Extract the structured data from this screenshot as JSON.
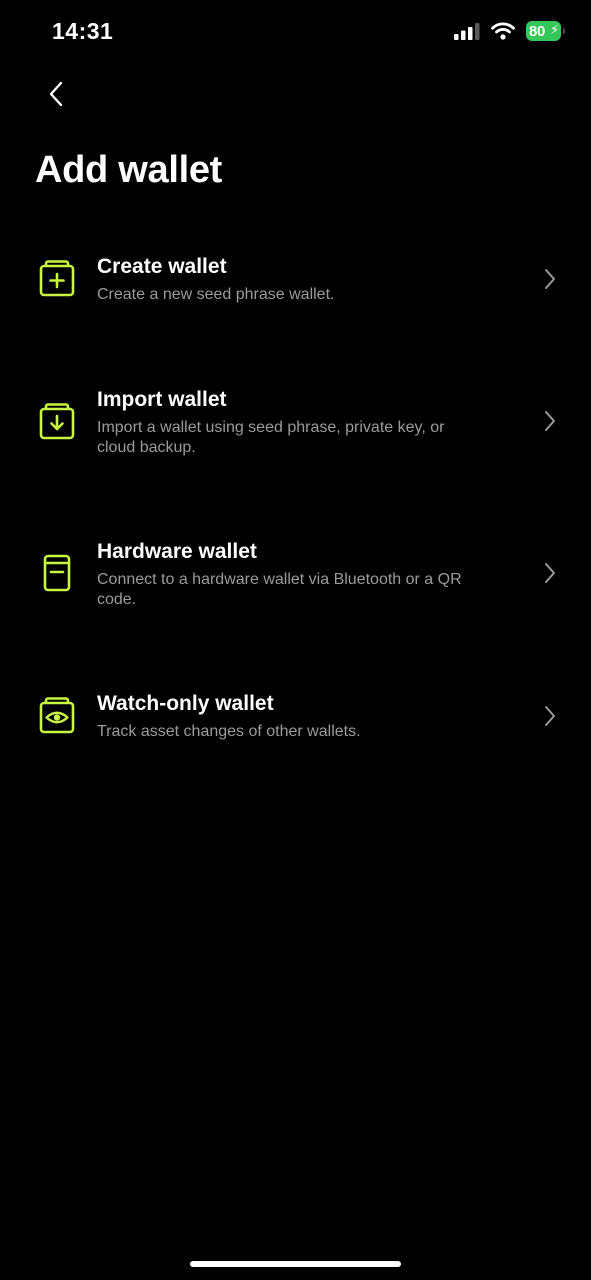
{
  "status_bar": {
    "time": "14:31",
    "battery_level": "80",
    "icons": [
      "signal-icon",
      "wifi-icon",
      "battery-icon",
      "charging-bolt-icon"
    ]
  },
  "header": {
    "back_icon": "chevron-left-icon",
    "title": "Add wallet"
  },
  "accent_color": "#c8f542",
  "options": [
    {
      "icon": "wallet-plus-icon",
      "title": "Create wallet",
      "description": "Create a new seed phrase wallet."
    },
    {
      "icon": "wallet-download-icon",
      "title": "Import wallet",
      "description": "Import a wallet using seed phrase, private key, or cloud backup."
    },
    {
      "icon": "hardware-wallet-icon",
      "title": "Hardware wallet",
      "description": "Connect to a hardware wallet via Bluetooth or a QR code."
    },
    {
      "icon": "wallet-eye-icon",
      "title": "Watch-only wallet",
      "description": "Track asset changes of other wallets."
    }
  ]
}
